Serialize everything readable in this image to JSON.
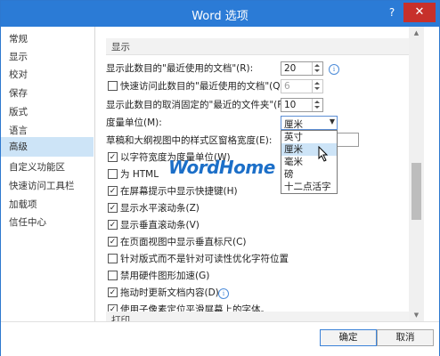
{
  "window": {
    "title": "Word 选项",
    "help": "?",
    "close": "✕"
  },
  "sidebar": {
    "items": [
      {
        "label": "常规"
      },
      {
        "label": "显示"
      },
      {
        "label": "校对"
      },
      {
        "label": "保存"
      },
      {
        "label": "版式"
      },
      {
        "label": "语言"
      },
      {
        "label": "高级"
      },
      {
        "label": "自定义功能区"
      },
      {
        "label": "快速访问工具栏"
      },
      {
        "label": "加载项"
      },
      {
        "label": "信任中心"
      }
    ],
    "active": "高级"
  },
  "display": {
    "heading": "显示",
    "recent_docs_label": "显示此数目的\"最近使用的文档\"(R):",
    "recent_docs_value": "20",
    "quick_access_label": "快速访问此数目的\"最近使用的文档\"(Q):",
    "quick_access_value": "6",
    "unpinned_folders_label": "显示此数目的取消固定的\"最近的文件夹\"(F):",
    "unpinned_folders_value": "10",
    "units_label": "度量单位(M):",
    "units_value": "厘米",
    "units_options": [
      "英寸",
      "厘米",
      "毫米",
      "磅",
      "十二点活字"
    ],
    "style_area_label": "草稿和大纲视图中的样式区窗格宽度(E):",
    "checkboxes": [
      {
        "label": "以字符宽度为度量单位(W)",
        "checked": true
      },
      {
        "label": "为 HTML",
        "checked": false
      },
      {
        "label": "在屏幕提示中显示快捷键(H)",
        "checked": true
      },
      {
        "label": "显示水平滚动条(Z)",
        "checked": true
      },
      {
        "label": "显示垂直滚动条(V)",
        "checked": true
      },
      {
        "label": "在页面视图中显示垂直标尺(C)",
        "checked": true
      },
      {
        "label": "针对版式而不是针对可读性优化字符位置",
        "checked": false
      },
      {
        "label": "禁用硬件图形加速(G)",
        "checked": false
      },
      {
        "label": "拖动时更新文档内容(D)",
        "checked": true
      },
      {
        "label": "使用子像素定位平滑屏幕上的字体。",
        "checked": true
      }
    ],
    "check_mark": "✓",
    "info_glyph": "i"
  },
  "print": {
    "heading": "打印"
  },
  "watermark": "WordHome",
  "buttons": {
    "ok": "确定",
    "cancel": "取消"
  },
  "scroll": {
    "up": "▲",
    "down": "▼"
  },
  "colors": {
    "titlebar": "#2b7bd6",
    "close": "#c7302b",
    "selection": "#cde4f7"
  }
}
